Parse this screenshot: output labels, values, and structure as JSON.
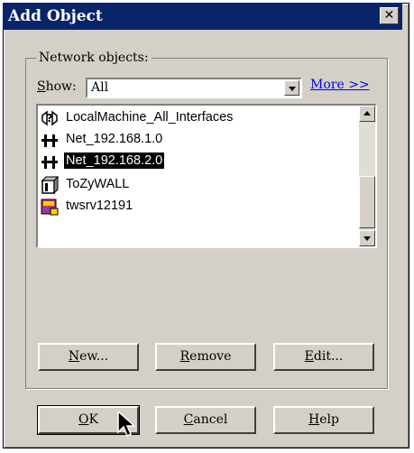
{
  "window": {
    "title": "Add Object",
    "close_label": "✕"
  },
  "group": {
    "label": "Network objects:"
  },
  "show": {
    "label": "Show:",
    "value": "All"
  },
  "more_link": "More >>",
  "list": {
    "items": [
      {
        "label": "LocalMachine_All_Interfaces",
        "icon": "unknown-object-icon",
        "selected": false
      },
      {
        "label": "Net_192.168.1.0",
        "icon": "network-icon",
        "selected": false
      },
      {
        "label": "Net_192.168.2.0",
        "icon": "network-icon",
        "selected": true
      },
      {
        "label": "ToZyWALL",
        "icon": "gateway-icon",
        "selected": false
      },
      {
        "label": "twsrv12191",
        "icon": "server-icon",
        "selected": false
      }
    ]
  },
  "buttons": {
    "new": {
      "mnemonic": "N",
      "rest": "ew..."
    },
    "remove": {
      "mnemonic": "R",
      "rest": "emove"
    },
    "edit": {
      "mnemonic": "E",
      "rest": "dit..."
    },
    "ok": {
      "mnemonic": "O",
      "rest": "K"
    },
    "cancel": {
      "mnemonic": "C",
      "rest": "ancel"
    },
    "help": {
      "mnemonic": "H",
      "rest": "elp"
    }
  }
}
